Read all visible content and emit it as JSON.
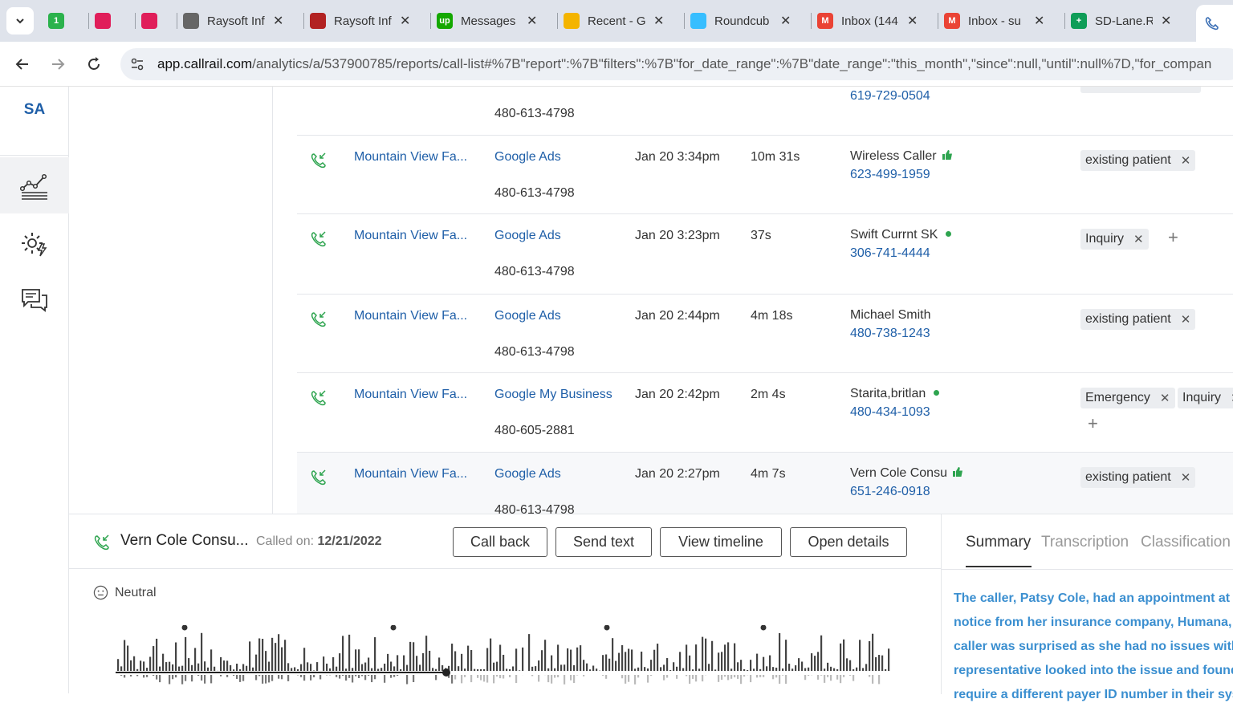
{
  "browser": {
    "tabs": [
      {
        "title": "",
        "favicon": "1",
        "color": "#2bb24c"
      },
      {
        "title": "",
        "favicon": "slack",
        "color": "#e01e5a"
      },
      {
        "title": "",
        "favicon": "slack",
        "color": "#e01e5a"
      },
      {
        "title": "Raysoft Inf",
        "favicon": "globe",
        "color": "#666666"
      },
      {
        "title": "Raysoft Inf",
        "favicon": "school",
        "color": "#b22222"
      },
      {
        "title": "Messages",
        "favicon": "up",
        "color": "#14a800"
      },
      {
        "title": "Recent - G",
        "favicon": "drive",
        "color": "#f4b400"
      },
      {
        "title": "Roundcub",
        "favicon": "rc",
        "color": "#37beff"
      },
      {
        "title": "Inbox (144",
        "favicon": "M",
        "color": "#ea4335"
      },
      {
        "title": "Inbox - su",
        "favicon": "M",
        "color": "#ea4335"
      },
      {
        "title": "SD-Lane.R",
        "favicon": "+",
        "color": "#0f9d58"
      }
    ],
    "url_host": "app.callrail.com",
    "url_path": "/analytics/a/537900785/reports/call-list#%7B\"report\":%7B\"filters\":%7B\"for_date_range\":%7B\"date_range\":\"this_month\",\"since\":null,\"until\":null%7D,\"for_compan"
  },
  "nav": {
    "account_initials": "SA"
  },
  "top_partial": {
    "tracking_number": "480-613-4798",
    "caller_number": "619-729-0504"
  },
  "calls": [
    {
      "company": "Mountain View Fa...",
      "source": "Google Ads",
      "tracking_number": "480-613-4798",
      "time": "Jan 20 3:34pm",
      "duration": "10m 31s",
      "caller_name": "Wireless Caller",
      "indicator": "thumb",
      "caller_number": "623-499-1959",
      "tags": [
        "existing patient"
      ]
    },
    {
      "company": "Mountain View Fa...",
      "source": "Google Ads",
      "tracking_number": "480-613-4798",
      "time": "Jan 20 3:23pm",
      "duration": "37s",
      "caller_name": "Swift Currnt SK",
      "indicator": "dot",
      "caller_number": "306-741-4444",
      "tags": [
        "Inquiry"
      ]
    },
    {
      "company": "Mountain View Fa...",
      "source": "Google Ads",
      "tracking_number": "480-613-4798",
      "time": "Jan 20 2:44pm",
      "duration": "4m 18s",
      "caller_name": "Michael Smith",
      "indicator": "",
      "caller_number": "480-738-1243",
      "tags": [
        "existing patient"
      ]
    },
    {
      "company": "Mountain View Fa...",
      "source": "Google My Business",
      "tracking_number": "480-605-2881",
      "time": "Jan 20 2:42pm",
      "duration": "2m 4s",
      "caller_name": "Starita,britlan",
      "indicator": "dot",
      "caller_number": "480-434-1093",
      "tags": [
        "Emergency",
        "Inquiry"
      ]
    },
    {
      "company": "Mountain View Fa...",
      "source": "Google Ads",
      "tracking_number": "480-613-4798",
      "time": "Jan 20 2:27pm",
      "duration": "4m 7s",
      "caller_name": "Vern Cole Consu",
      "indicator": "thumb",
      "caller_number": "651-246-0918",
      "tags": [
        "existing patient"
      ]
    }
  ],
  "detail": {
    "caller_name": "Vern Cole Consu...",
    "called_on_label": "Called on:",
    "called_on_date": "12/21/2022",
    "buttons": {
      "call_back": "Call back",
      "send_text": "Send text",
      "view_timeline": "View timeline",
      "open_details": "Open details"
    },
    "sentiment": "Neutral",
    "tabs": [
      "Summary",
      "Transcription",
      "Classification"
    ],
    "summary_lines": [
      "The caller, Patsy Cole, had an appointment at M",
      "notice from her insurance company, Humana, c",
      "caller was surprised as she had no issues with c",
      "representative looked into the issue and found",
      "require a different payer ID number in their sys"
    ]
  },
  "colors": {
    "link": "#1f5fa8",
    "summary": "#3b8fd0",
    "positive": "#2ea44f"
  }
}
